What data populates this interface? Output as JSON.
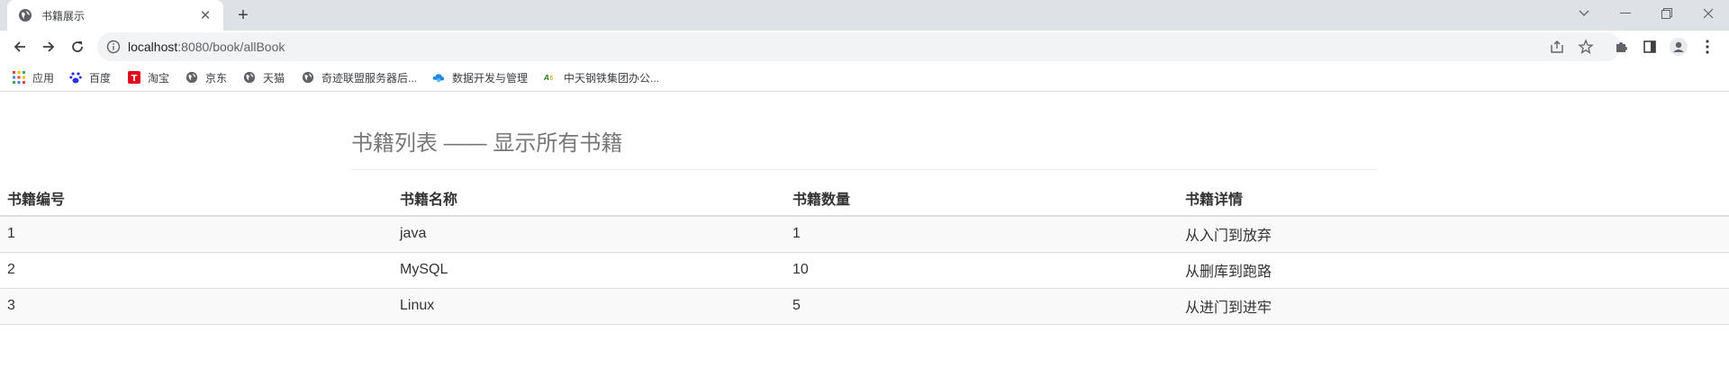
{
  "browser": {
    "tab": {
      "title": "书籍展示",
      "favicon": "globe-icon"
    },
    "new_tab_symbol": "+",
    "url": {
      "host": "localhost",
      "path": ":8080/book/allBook"
    },
    "bookmarks": [
      {
        "label": "应用",
        "icon": "apps-grid-icon"
      },
      {
        "label": "百度",
        "icon": "baidu-paw-icon"
      },
      {
        "label": "淘宝",
        "icon": "taobao-icon"
      },
      {
        "label": "京东",
        "icon": "globe-icon"
      },
      {
        "label": "天猫",
        "icon": "globe-icon"
      },
      {
        "label": "奇迹联盟服务器后...",
        "icon": "globe-icon"
      },
      {
        "label": "数据开发与管理",
        "icon": "cloud-icon"
      },
      {
        "label": "中天钢铁集团办公...",
        "icon": "logo-icon"
      }
    ]
  },
  "page": {
    "title": "书籍列表 —— 显示所有书籍",
    "table": {
      "headers": [
        "书籍编号",
        "书籍名称",
        "书籍数量",
        "书籍详情"
      ],
      "rows": [
        [
          "1",
          "java",
          "1",
          "从入门到放弃"
        ],
        [
          "2",
          "MySQL",
          "10",
          "从删库到跑路"
        ],
        [
          "3",
          "Linux",
          "5",
          "从进门到进牢"
        ]
      ]
    }
  },
  "colors": {
    "tabstrip": "#dee1e6",
    "title": "#777777",
    "stripe": "#f9f9f9",
    "border": "#dddddd"
  }
}
